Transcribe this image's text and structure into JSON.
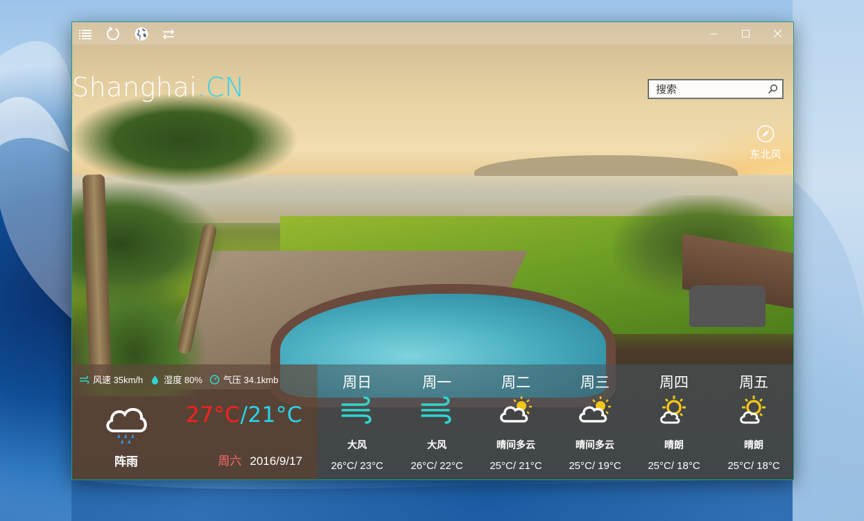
{
  "window": {
    "toolbar": [
      {
        "name": "menu-icon"
      },
      {
        "name": "refresh-icon"
      },
      {
        "name": "globe-icon"
      },
      {
        "name": "switch-icon"
      }
    ],
    "controls": [
      "minimize",
      "maximize",
      "close"
    ]
  },
  "location": {
    "city": "Shanghai",
    "country": ".CN"
  },
  "search": {
    "placeholder": "搜索"
  },
  "wind_direction": {
    "label": "东北风",
    "icon": "compass-icon"
  },
  "today": {
    "wind_speed": "风速 35km/h",
    "humidity": "湿度 80%",
    "pressure": "气压 34.1kmb",
    "condition": "阵雨",
    "icon": "rain-cloud-icon",
    "high": "27°C",
    "separator": "/",
    "low": "21°C",
    "weekday": "周六",
    "date": "2016/9/17"
  },
  "forecast": [
    {
      "day": "周日",
      "condition": "大风",
      "icon": "wind-icon",
      "range": "26°C/ 23°C"
    },
    {
      "day": "周一",
      "condition": "大风",
      "icon": "wind-icon",
      "range": "26°C/ 22°C"
    },
    {
      "day": "周二",
      "condition": "晴间多云",
      "icon": "partly-cloudy-icon",
      "range": "25°C/ 21°C"
    },
    {
      "day": "周三",
      "condition": "晴间多云",
      "icon": "partly-cloudy-icon",
      "range": "25°C/ 19°C"
    },
    {
      "day": "周四",
      "condition": "晴朗",
      "icon": "sunny-cloud-icon",
      "range": "25°C/ 18°C"
    },
    {
      "day": "周五",
      "condition": "晴朗",
      "icon": "sunny-cloud-icon",
      "range": "25°C/ 18°C"
    }
  ],
  "colors": {
    "accent": "#33d2ea",
    "high_temp": "#ff1f1f",
    "low_temp": "#26d6f0",
    "weekday": "#ff6a6a",
    "sun": "#f5c518",
    "wind": "#2fd6d0"
  }
}
